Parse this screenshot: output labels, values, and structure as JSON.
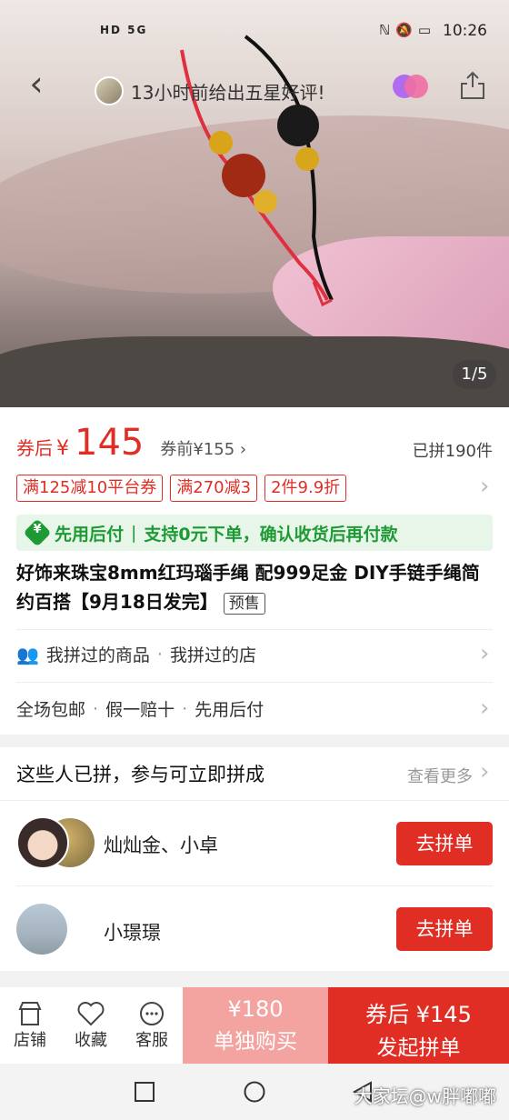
{
  "status_bar": {
    "left_indicators": "HD 5G",
    "time": "10:26"
  },
  "header": {
    "review_text": "13小时前给出五星好评!"
  },
  "photo": {
    "counter": "1/5"
  },
  "price": {
    "after_label": "券后",
    "currency": "¥",
    "after_price": "145",
    "before_price": "券前¥155",
    "sold": "已拼190件"
  },
  "coupons": [
    "满125减10平台券",
    "满270减3",
    "2件9.9折"
  ],
  "paylater": {
    "label": "先用后付",
    "separator": "|",
    "desc": "支持0元下单，确认收货后再付款"
  },
  "product": {
    "title": "好饰来珠宝8mm红玛瑙手绳 配999足金 DIY手链手绳简约百搭【9月18日发完】",
    "tag": "预售"
  },
  "history": {
    "items_label": "我拼过的商品",
    "shops_label": "我拼过的店"
  },
  "services": [
    "全场包邮",
    "假一赔十",
    "先用后付"
  ],
  "groups_section": {
    "title": "这些人已拼，参与可立即拼成",
    "more": "查看更多",
    "groups": [
      {
        "names": "灿灿金、小卓",
        "button": "去拼单"
      },
      {
        "names": "小璟璟",
        "button": "去拼单"
      }
    ]
  },
  "bottom_bar": {
    "store": "店铺",
    "favorite": "收藏",
    "service": "客服",
    "alone_price": "¥180",
    "alone_label": "单独购买",
    "group_price": "券后 ¥145",
    "group_label": "发起拼单"
  },
  "watermark": "大家坛@w胖嘟嘟"
}
